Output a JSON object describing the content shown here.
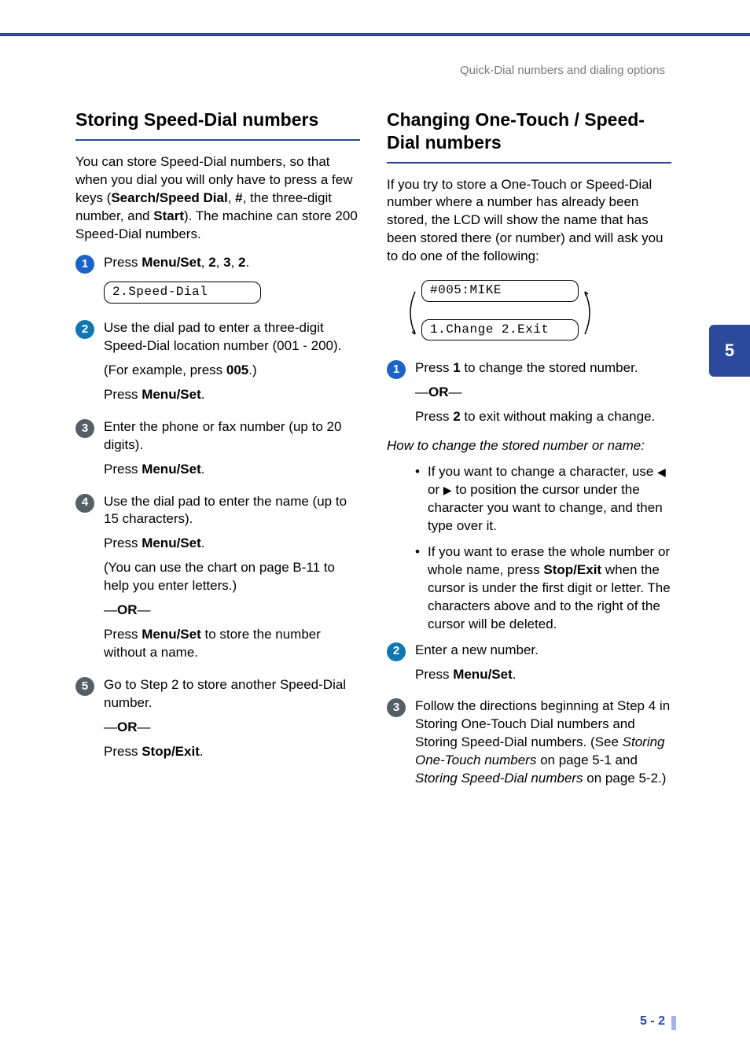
{
  "header": {
    "label": "Quick-Dial numbers and dialing options"
  },
  "chapter_tab": "5",
  "page_number": "5 - 2",
  "left": {
    "heading": "Storing Speed-Dial numbers",
    "intro_1": "You can store Speed-Dial numbers, so that when you dial you will only have to press a few keys (",
    "intro_b1": "Search/Speed Dial",
    "intro_2": ", ",
    "intro_b2": "#",
    "intro_3": ", the three-digit number, and ",
    "intro_b3": "Start",
    "intro_4": "). The machine can store 200 Speed-Dial numbers.",
    "s1_a": "Press ",
    "s1_b1": "Menu/Set",
    "s1_c": ", ",
    "s1_b2": "2",
    "s1_d": ", ",
    "s1_b3": "3",
    "s1_e": ", ",
    "s1_b4": "2",
    "s1_f": ".",
    "lcd1": "2.Speed-Dial",
    "s2_a": "Use the dial pad to enter a three-digit Speed-Dial location number (001 - 200).",
    "s2_b": "(For example, press ",
    "s2_bb": "005",
    "s2_c": ".)",
    "s2_d": "Press ",
    "s2_db": "Menu/Set",
    "s2_e": ".",
    "s3_a": "Enter the phone or fax number (up to 20 digits).",
    "s3_b": "Press ",
    "s3_bb": "Menu/Set",
    "s3_c": ".",
    "s4_a": "Use the dial pad to enter the name (up to 15 characters).",
    "s4_b": "Press ",
    "s4_bb": "Menu/Set",
    "s4_c": ".",
    "s4_d": "(You can use the chart on page B-11 to help you enter letters.)",
    "s4_or": "—",
    "s4_orb": "OR",
    "s4_or2": "—",
    "s4_e": "Press ",
    "s4_eb": "Menu/Set",
    "s4_f": " to store the number without a name.",
    "s5_a": "Go to Step 2 to store another Speed-Dial number.",
    "s5_or": "—",
    "s5_orb": "OR",
    "s5_or2": "—",
    "s5_b": "Press ",
    "s5_bb": "Stop/Exit",
    "s5_c": "."
  },
  "right": {
    "heading": "Changing One-Touch / Speed-Dial numbers",
    "intro": "If you try to store a One-Touch or Speed-Dial number where a number has already been stored, the LCD will show the name that has been stored there (or number) and will ask you to do one of the following:",
    "lcd_top": "#005:MIKE",
    "lcd_bot": "1.Change  2.Exit",
    "s1_a": "Press ",
    "s1_b": "1",
    "s1_c": " to change the stored number.",
    "s1_or": "—",
    "s1_orb": "OR",
    "s1_or2": "—",
    "s1_d": "Press ",
    "s1_db": "2",
    "s1_e": " to exit without making a change.",
    "howto": "How to change the stored number or name:",
    "bul1_a": "If you want to change a character, use ",
    "bul1_l": "◀",
    "bul1_or": " or ",
    "bul1_r": "▶",
    "bul1_b": " to position the cursor under the character you want to change, and then type over it.",
    "bul2_a": "If you want to erase the whole number or whole name, press ",
    "bul2_b": "Stop/Exit",
    "bul2_c": " when the cursor is under the first digit or letter. The characters above and to the right of the cursor will be deleted.",
    "s2_a": "Enter a new number.",
    "s2_b": "Press ",
    "s2_bb": "Menu/Set",
    "s2_c": ".",
    "s3_a": "Follow the directions beginning at Step 4 in Storing One-Touch Dial numbers and Storing Speed-Dial numbers. (See ",
    "s3_i1": "Storing One-Touch numbers",
    "s3_b": " on page 5-1 and ",
    "s3_i2": "Storing Speed-Dial numbers",
    "s3_c": " on page 5-2.)"
  }
}
